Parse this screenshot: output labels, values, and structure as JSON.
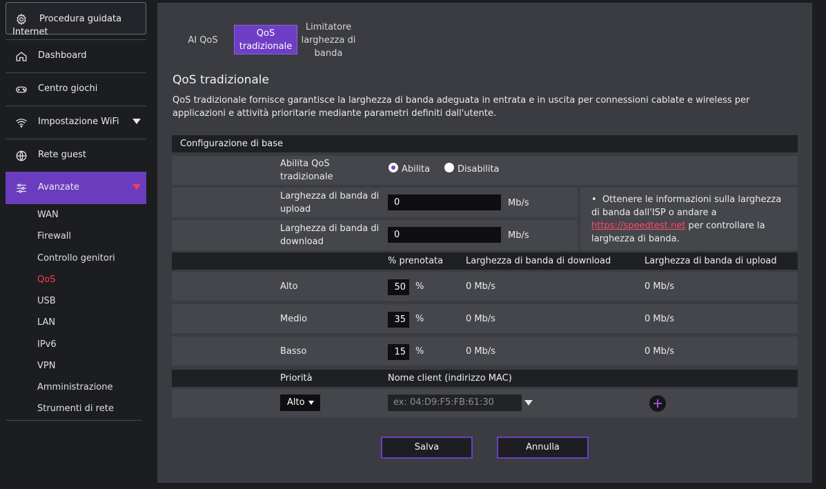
{
  "sidebar": {
    "wizard": {
      "label_line1": "Procedura guidata",
      "label_line2": "Internet",
      "icon": "gear-icon"
    },
    "items": [
      {
        "label": "Dashboard",
        "icon": "home-icon"
      },
      {
        "label": "Centro giochi",
        "icon": "gamepad-icon"
      },
      {
        "label": "Impostazione WiFi",
        "icon": "wifi-icon"
      },
      {
        "label": "Rete guest",
        "icon": "globe-icon"
      },
      {
        "label": "Avanzate",
        "icon": "sliders-icon"
      }
    ],
    "subitems": [
      "WAN",
      "Firewall",
      "Controllo genitori",
      "QoS",
      "USB",
      "LAN",
      "IPv6",
      "VPN",
      "Amministrazione",
      "Strumenti di rete"
    ],
    "current_subitem": "QoS",
    "accent_color": "#6b3dbe",
    "active_color": "#ff3a55"
  },
  "tabs": [
    {
      "label": "AI QoS"
    },
    {
      "label": "QoS tradizionale"
    },
    {
      "label": "Limitatore larghezza di banda"
    }
  ],
  "page": {
    "title": "QoS tradizionale",
    "description": "QoS tradizionale fornisce garantisce la larghezza di banda adeguata in entrata e in uscita per connessioni cablate e wireless per applicazioni e attività prioritarie mediante parametri definiti dall'utente."
  },
  "config": {
    "section_title": "Configurazione di base",
    "enable_label": "Abilita QoS tradizionale",
    "enable_option": "Abilita",
    "disable_option": "Disabilita",
    "upload_label": "Larghezza di banda di upload",
    "upload_value": "0",
    "download_label": "Larghezza di banda di download",
    "download_value": "0",
    "unit": "Mb/s",
    "info_bullet": "•",
    "info_text_before": "Ottenere le informazioni sulla larghezza di banda dall'ISP o andare a",
    "info_link": "https://speedtest.net",
    "info_text_after": "per controllare la larghezza di banda."
  },
  "priority_table": {
    "headers": [
      "% prenotata",
      "Larghezza di banda di download",
      "Larghezza di banda di upload"
    ],
    "pct_symbol": "%",
    "rows": [
      {
        "name": "Alto",
        "pct": "50",
        "download": "0 Mb/s",
        "upload": "0 Mb/s"
      },
      {
        "name": "Medio",
        "pct": "35",
        "download": "0 Mb/s",
        "upload": "0 Mb/s"
      },
      {
        "name": "Basso",
        "pct": "15",
        "download": "0 Mb/s",
        "upload": "0 Mb/s"
      }
    ]
  },
  "client_table": {
    "headers": [
      "Priorità",
      "Nome client (indirizzo MAC)"
    ],
    "priority_value": "Alto",
    "mac_placeholder": "ex: 04:D9:F5:FB:61:30"
  },
  "buttons": {
    "save": "Salva",
    "cancel": "Annulla"
  }
}
